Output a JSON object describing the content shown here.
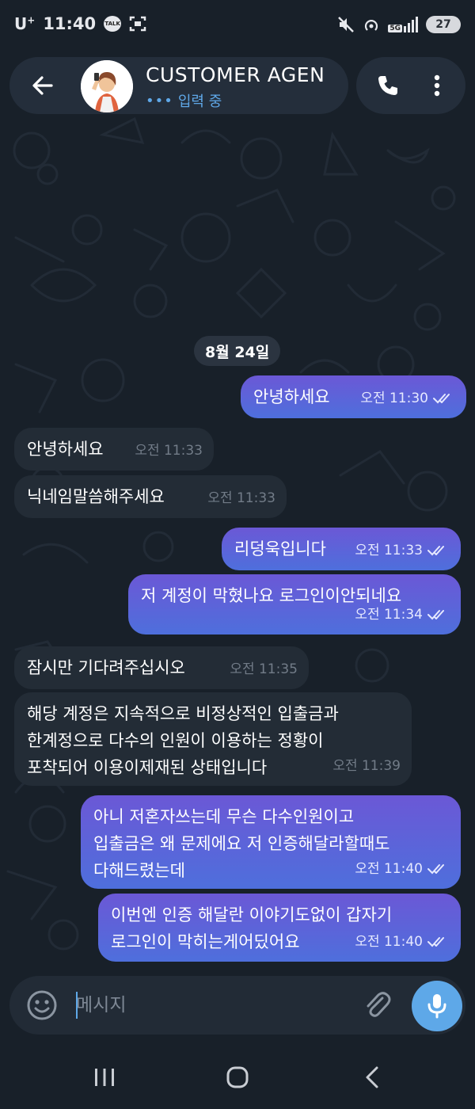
{
  "status_bar": {
    "carrier": "U",
    "carrier_sup": "+",
    "time": "11:40",
    "talk_badge": "TALK",
    "network_badge": "5G",
    "battery": "27"
  },
  "header": {
    "title": "CUSTOMER AGEN",
    "status": "입력 중"
  },
  "date_separator": "8월 24일",
  "messages": [
    {
      "dir": "out",
      "text": "안녕하세요",
      "time": "오전 11:30",
      "read": true
    },
    {
      "dir": "in",
      "text": "안녕하세요",
      "time": "오전 11:33"
    },
    {
      "dir": "in",
      "text": "닉네임말씀해주세요",
      "time": "오전 11:33"
    },
    {
      "dir": "out",
      "text": "리덩욱입니다",
      "time": "오전 11:33",
      "read": true
    },
    {
      "dir": "out",
      "text": "저 계정이 막혔나요 로그인이안되네요",
      "time": "오전 11:34",
      "read": true
    },
    {
      "dir": "in",
      "text": "잠시만 기다려주십시오",
      "time": "오전 11:35"
    },
    {
      "dir": "in",
      "lines": [
        "해당 계정은 지속적으로 비정상적인 입출금과",
        "한계정으로 다수의 인원이 이용하는 정황이",
        "포착되어 이용이제재된 상태입니다"
      ],
      "time": "오전 11:39"
    },
    {
      "dir": "out",
      "lines": [
        "아니 저혼자쓰는데 무슨 다수인원이고",
        "입출금은 왜 문제에요 저 인증해달라할때도",
        "다해드렸는데"
      ],
      "time": "오전 11:40",
      "read": true
    },
    {
      "dir": "out",
      "lines": [
        "이번엔 인증 해달란 이야기도없이 갑자기",
        "로그인이 막히는게어딨어요"
      ],
      "time": "오전 11:40",
      "read": true
    }
  ],
  "composer": {
    "placeholder": "메시지"
  },
  "colors": {
    "background": "#182029",
    "incoming_bubble": "#232c36",
    "outgoing_bubble_top": "#6b58d6",
    "outgoing_bubble_bottom": "#4e6fdc",
    "accent": "#5ea8e8"
  },
  "icons": [
    "back-arrow-icon",
    "phone-icon",
    "more-vertical-icon",
    "emoji-icon",
    "paperclip-icon",
    "microphone-icon",
    "read-double-check-icon",
    "recents-icon",
    "home-icon",
    "back-nav-icon"
  ]
}
